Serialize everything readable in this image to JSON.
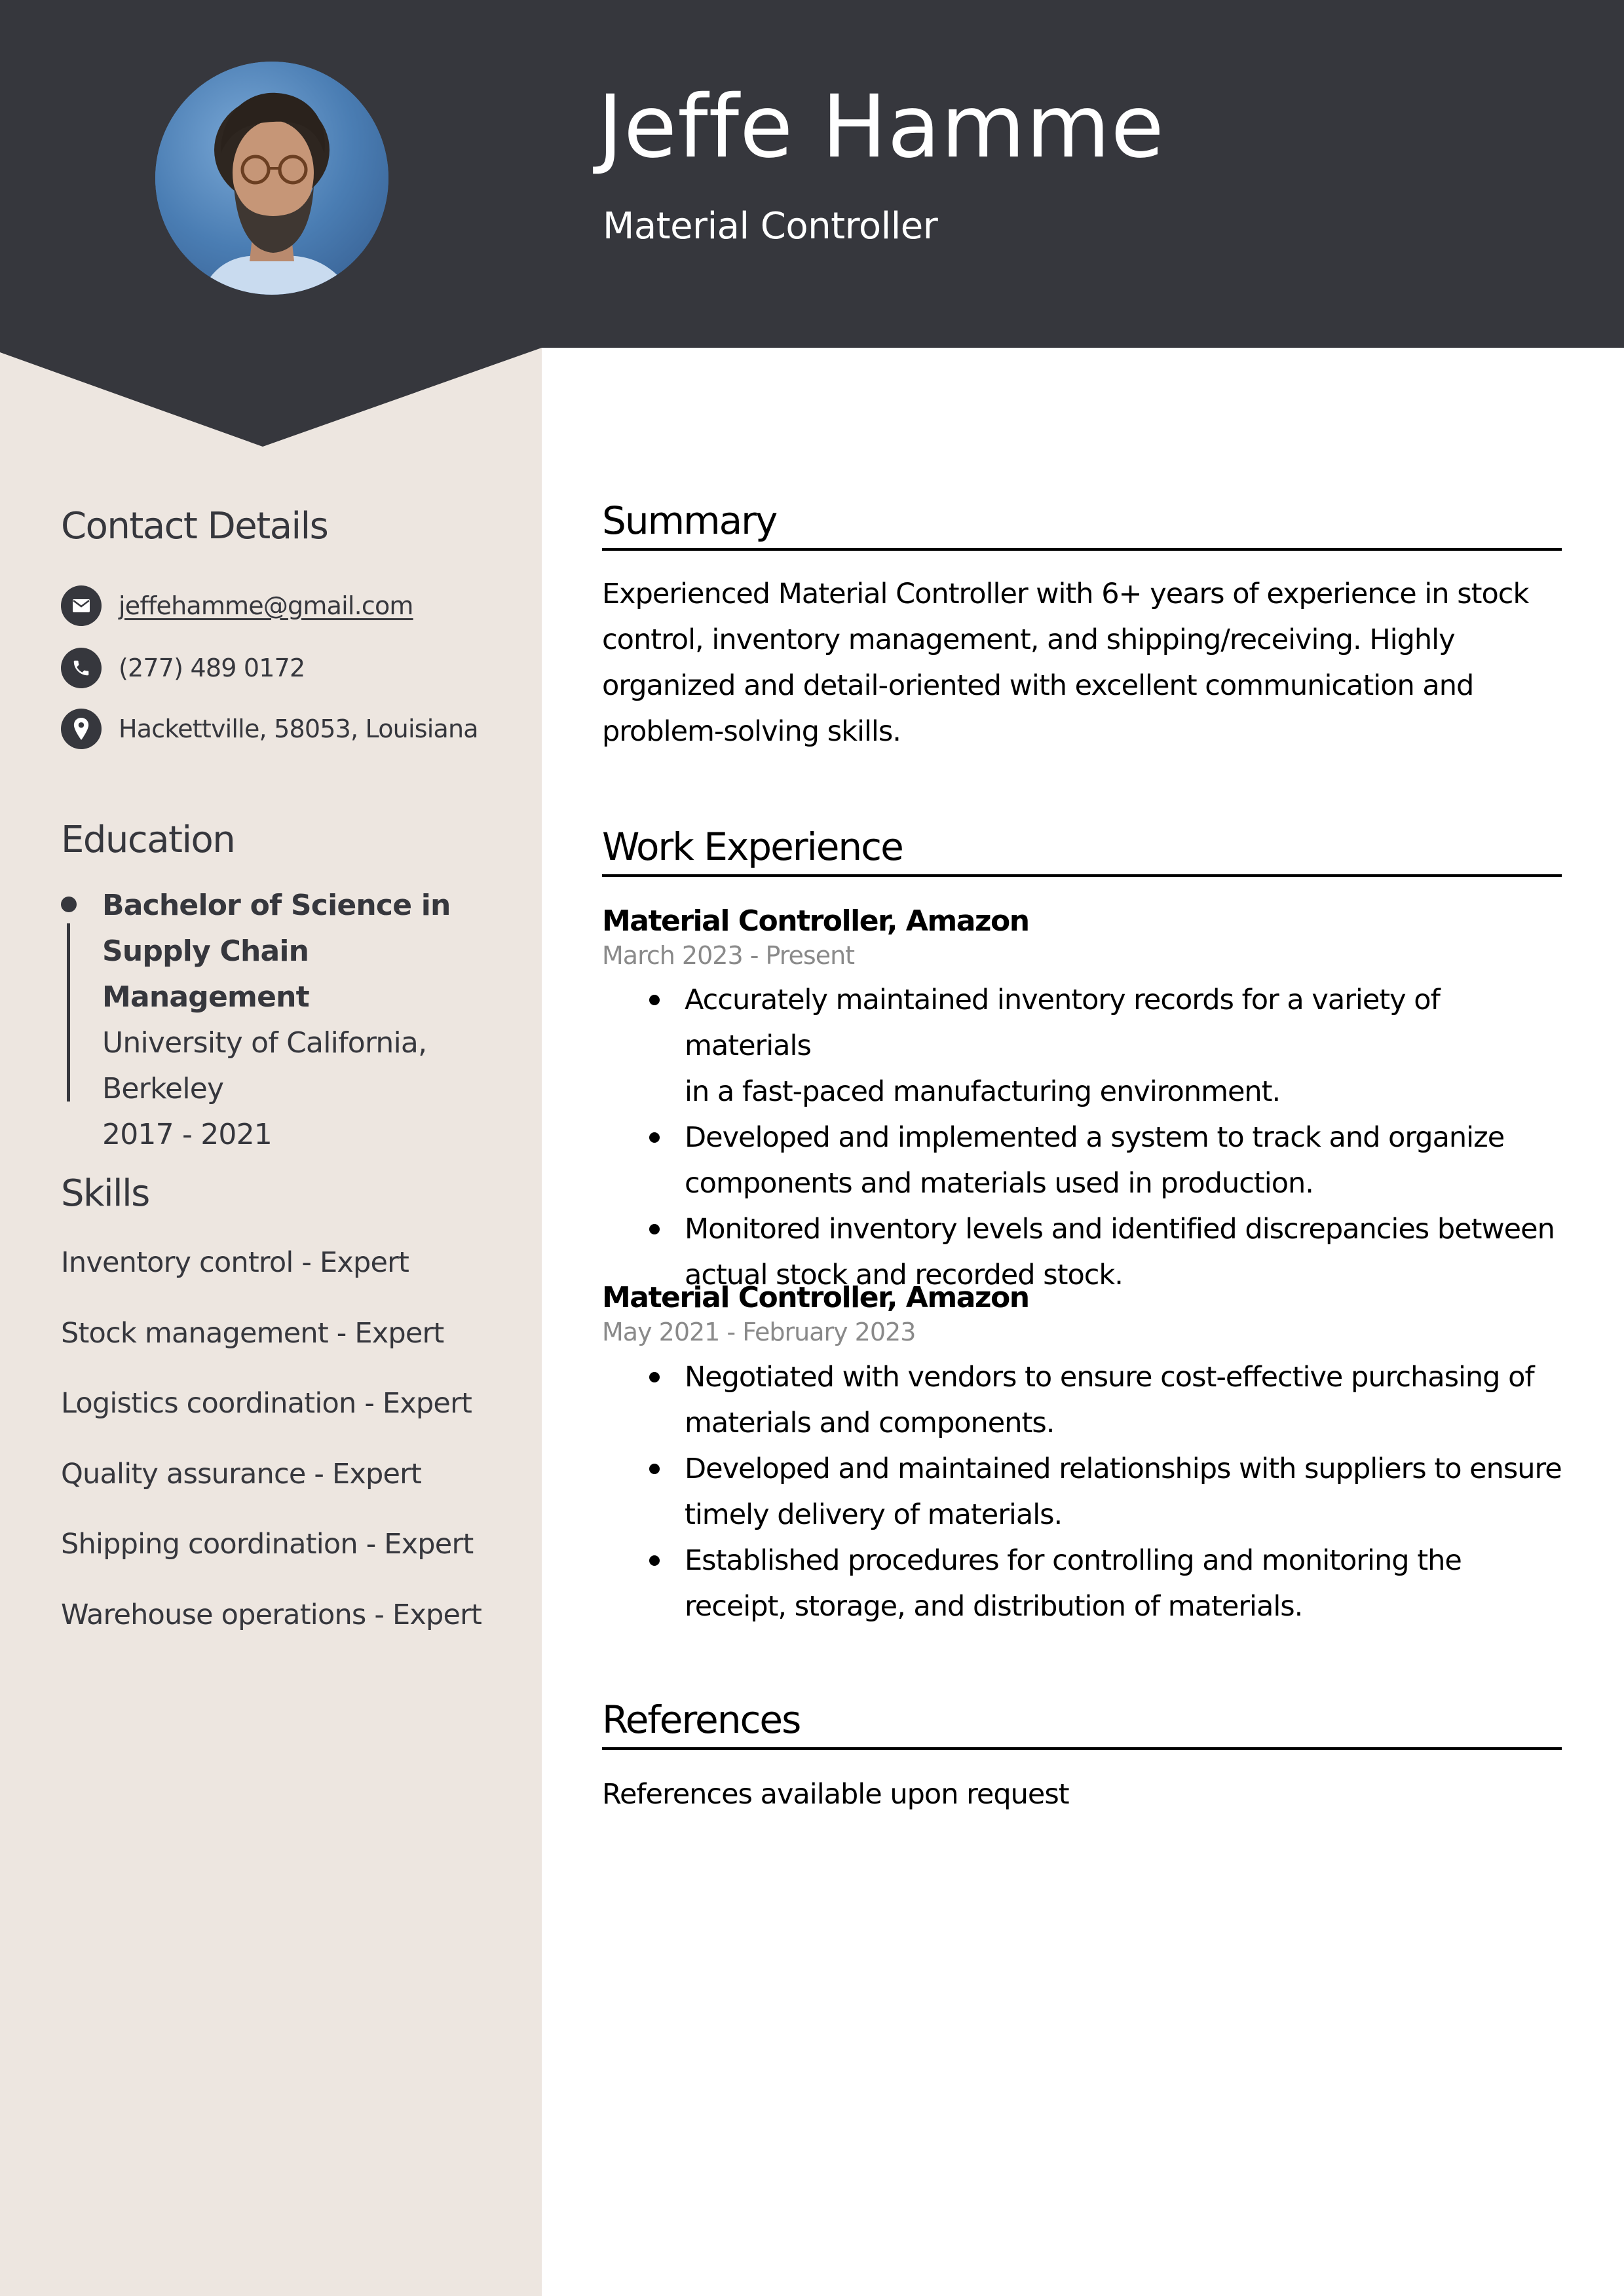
{
  "colors": {
    "header_bg": "#36373d",
    "sidebar_bg": "#ede6e0",
    "text_dark": "#36373d",
    "date_gray": "#8a8a8a"
  },
  "header": {
    "name": "Jeffe Hamme",
    "title": "Material Controller",
    "photo_alt": "profile-photo"
  },
  "sidebar": {
    "contact": {
      "heading": "Contact Details",
      "items": [
        {
          "icon": "email-icon",
          "text": "jeffehamme@gmail.com"
        },
        {
          "icon": "phone-icon",
          "text": "(277) 489 0172"
        },
        {
          "icon": "location-pin-icon",
          "text": "Hackettville, 58053, Louisiana"
        }
      ]
    },
    "education": {
      "heading": "Education",
      "degree_line1": "Bachelor of Science in",
      "degree_line2": "Supply Chain Management",
      "school_line1": "University of California,",
      "school_line2": "Berkeley",
      "years": "2017 - 2021"
    },
    "skills": {
      "heading": "Skills",
      "items": [
        "Inventory control - Expert",
        "Stock management - Expert",
        "Logistics coordination - Expert",
        "Quality assurance - Expert",
        "Shipping coordination - Expert",
        "Warehouse operations - Expert"
      ]
    }
  },
  "main": {
    "summary": {
      "heading": "Summary",
      "lines": [
        "Experienced Material Controller with 6+ years of experience in stock",
        "control, inventory management, and shipping/receiving. Highly",
        "organized and detail-oriented with excellent communication and",
        "problem-solving skills."
      ]
    },
    "work": {
      "heading": "Work Experience",
      "jobs": [
        {
          "title": "Material Controller, Amazon",
          "dates": "March 2023 - Present",
          "bullets": [
            [
              "Accurately maintained inventory records for a variety of materials",
              "in a fast-paced manufacturing environment."
            ],
            [
              "Developed and implemented a system to track and organize",
              "components and materials used in production."
            ],
            [
              "Monitored inventory levels and identified discrepancies between",
              "actual stock and recorded stock."
            ]
          ]
        },
        {
          "title": "Material Controller, Amazon",
          "dates": "May 2021 - February 2023",
          "bullets": [
            [
              "Negotiated with vendors to ensure cost-effective purchasing of",
              "materials and components."
            ],
            [
              "Developed and maintained relationships with suppliers to ensure",
              "timely delivery of materials."
            ],
            [
              "Established procedures for controlling and monitoring the",
              "receipt, storage, and distribution of materials."
            ]
          ]
        }
      ]
    },
    "references": {
      "heading": "References",
      "text": "References available upon request"
    }
  }
}
